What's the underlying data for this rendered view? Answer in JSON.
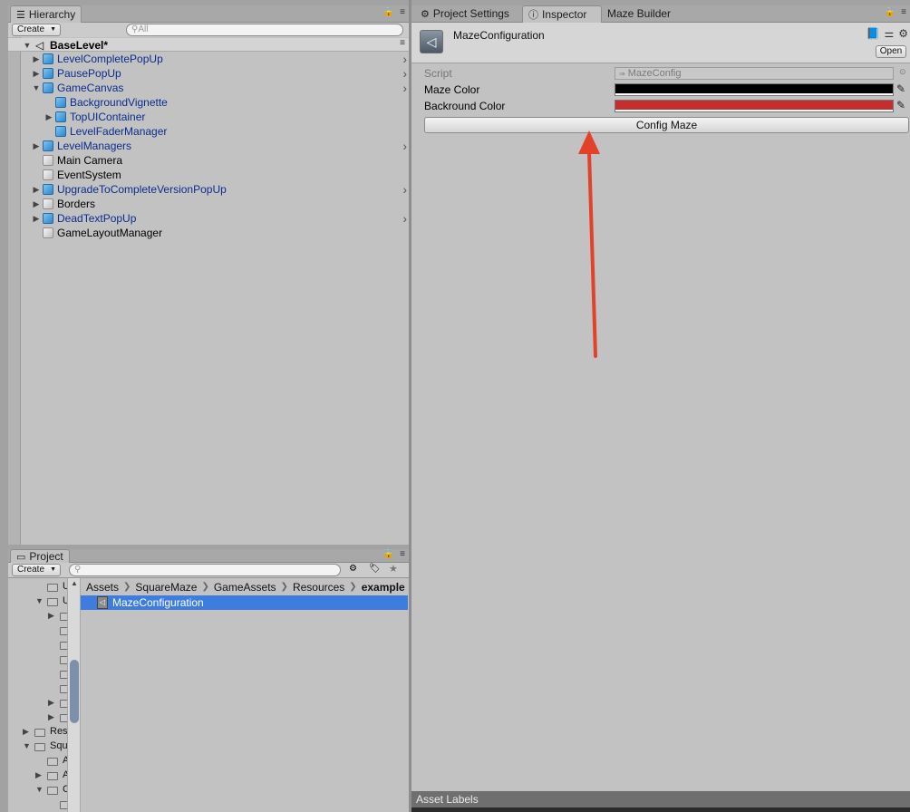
{
  "hierarchy": {
    "tab_label": "Hierarchy",
    "create_label": "Create",
    "search_placeholder": "All",
    "scene_name": "BaseLevel*",
    "rows": [
      {
        "label": "LevelCompletePopUp",
        "depth": 1,
        "expander": "collapsed",
        "prefab": true,
        "chevron": true
      },
      {
        "label": "PausePopUp",
        "depth": 1,
        "expander": "collapsed",
        "prefab": true,
        "chevron": true
      },
      {
        "label": "GameCanvas",
        "depth": 1,
        "expander": "expanded",
        "prefab": true,
        "chevron": true
      },
      {
        "label": "BackgroundVignette",
        "depth": 2,
        "expander": "none",
        "prefab": true,
        "chevron": false
      },
      {
        "label": "TopUIContainer",
        "depth": 2,
        "expander": "collapsed",
        "prefab": true,
        "chevron": false
      },
      {
        "label": "LevelFaderManager",
        "depth": 2,
        "expander": "none",
        "prefab": true,
        "chevron": false
      },
      {
        "label": "LevelManagers",
        "depth": 1,
        "expander": "collapsed",
        "prefab": true,
        "chevron": true
      },
      {
        "label": "Main Camera",
        "depth": 1,
        "expander": "none",
        "prefab": false,
        "chevron": false
      },
      {
        "label": "EventSystem",
        "depth": 1,
        "expander": "none",
        "prefab": false,
        "chevron": false
      },
      {
        "label": "UpgradeToCompleteVersionPopUp",
        "depth": 1,
        "expander": "collapsed",
        "prefab": true,
        "chevron": true
      },
      {
        "label": "Borders",
        "depth": 1,
        "expander": "collapsed",
        "prefab": false,
        "chevron": false
      },
      {
        "label": "DeadTextPopUp",
        "depth": 1,
        "expander": "collapsed",
        "prefab": true,
        "chevron": true
      },
      {
        "label": "GameLayoutManager",
        "depth": 1,
        "expander": "none",
        "prefab": false,
        "chevron": false
      }
    ]
  },
  "right_tabs": {
    "project_settings": "Project Settings",
    "inspector": "Inspector",
    "maze_builder": "Maze Builder"
  },
  "inspector": {
    "object_name": "MazeConfiguration",
    "open_label": "Open",
    "script_label": "Script",
    "script_value": "MazeConfig",
    "maze_color_label": "Maze Color",
    "maze_color": "#000000",
    "background_color_label": "Backround Color",
    "background_color": "#c62d2d",
    "config_button_label": "Config Maze"
  },
  "project": {
    "tab_label": "Project",
    "create_label": "Create",
    "breadcrumb": [
      "Assets",
      "SquareMaze",
      "GameAssets",
      "Resources",
      "example"
    ],
    "selected_item": "MazeConfiguration",
    "tree_texts": [
      "U",
      "U",
      "Res",
      "Squ",
      "A",
      "A",
      "C"
    ]
  },
  "footer": {
    "asset_labels": "Asset Labels"
  },
  "annotation": {
    "arrow_color": "#e2412a"
  }
}
